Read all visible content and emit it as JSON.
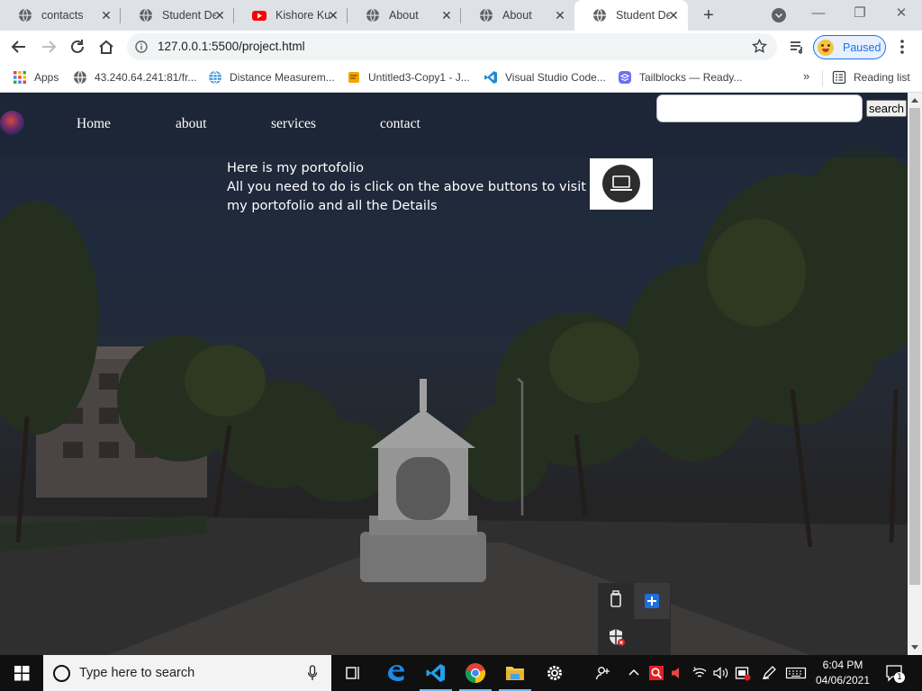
{
  "browser": {
    "tabs": [
      {
        "title": "contacts",
        "icon": "globe-icon",
        "active": false
      },
      {
        "title": "Student Det",
        "icon": "globe-icon",
        "active": false
      },
      {
        "title": "Kishore Kun",
        "icon": "youtube-icon",
        "active": false
      },
      {
        "title": "About",
        "icon": "globe-icon",
        "active": false
      },
      {
        "title": "About",
        "icon": "globe-icon",
        "active": false
      },
      {
        "title": "Student Det",
        "icon": "globe-icon",
        "active": true
      }
    ],
    "tab_close_glyph": "✕",
    "new_tab_glyph": "+",
    "window_controls": {
      "minimize": "—",
      "restore": "❐",
      "close": "✕"
    },
    "url": "127.0.0.1:5500/project.html",
    "profile_status": "Paused",
    "bookmarks": [
      {
        "label": "Apps",
        "icon": "apps-grid-icon"
      },
      {
        "label": "43.240.64.241:81/fr...",
        "icon": "globe-icon"
      },
      {
        "label": "Distance Measurem...",
        "icon": "globe-blue-icon"
      },
      {
        "label": "Untitled3-Copy1 - J...",
        "icon": "jupyter-icon"
      },
      {
        "label": "Visual Studio Code...",
        "icon": "vscode-icon"
      },
      {
        "label": "Tailblocks — Ready...",
        "icon": "tailblocks-icon"
      }
    ],
    "bookmarks_overflow": "»",
    "reading_list": "Reading list"
  },
  "page": {
    "nav_links": [
      "Home",
      "about",
      "services",
      "contact"
    ],
    "search_button": "search",
    "search_value": "",
    "intro_line1": "Here is my portofolio",
    "intro_line2": "All you need to do is click on the above buttons to visit my portofolio and all the Details"
  },
  "taskbar": {
    "search_placeholder": "Type here to search",
    "time": "6:04 PM",
    "date": "04/06/2021",
    "notification_count": "1"
  },
  "colors": {
    "accent": "#1a73e8",
    "page_overlay": "#1a2434",
    "taskbar": "#101010"
  }
}
